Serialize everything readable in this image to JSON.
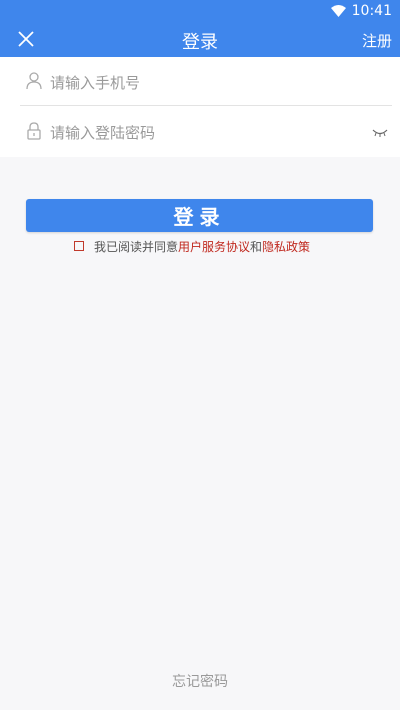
{
  "status_bar": {
    "time": "10:41",
    "wifi_icon": "wifi-icon"
  },
  "header": {
    "title": "登录",
    "close_icon": "close-icon",
    "register_label": "注册"
  },
  "form": {
    "phone_placeholder": "请输入手机号",
    "phone_icon": "user-icon",
    "password_placeholder": "请输入登陆密码",
    "password_icon": "lock-icon",
    "visibility_icon": "eye-closed-icon"
  },
  "login_button_label": "登录",
  "agreement": {
    "prefix": "我已阅读并同意",
    "user_agreement": "用户服务协议",
    "and": "和",
    "privacy_policy": "隐私政策"
  },
  "forgot_password_label": "忘记密码",
  "colors": {
    "primary": "#3f86ec",
    "link_red": "#c0281e",
    "background": "#f7f7f9"
  }
}
